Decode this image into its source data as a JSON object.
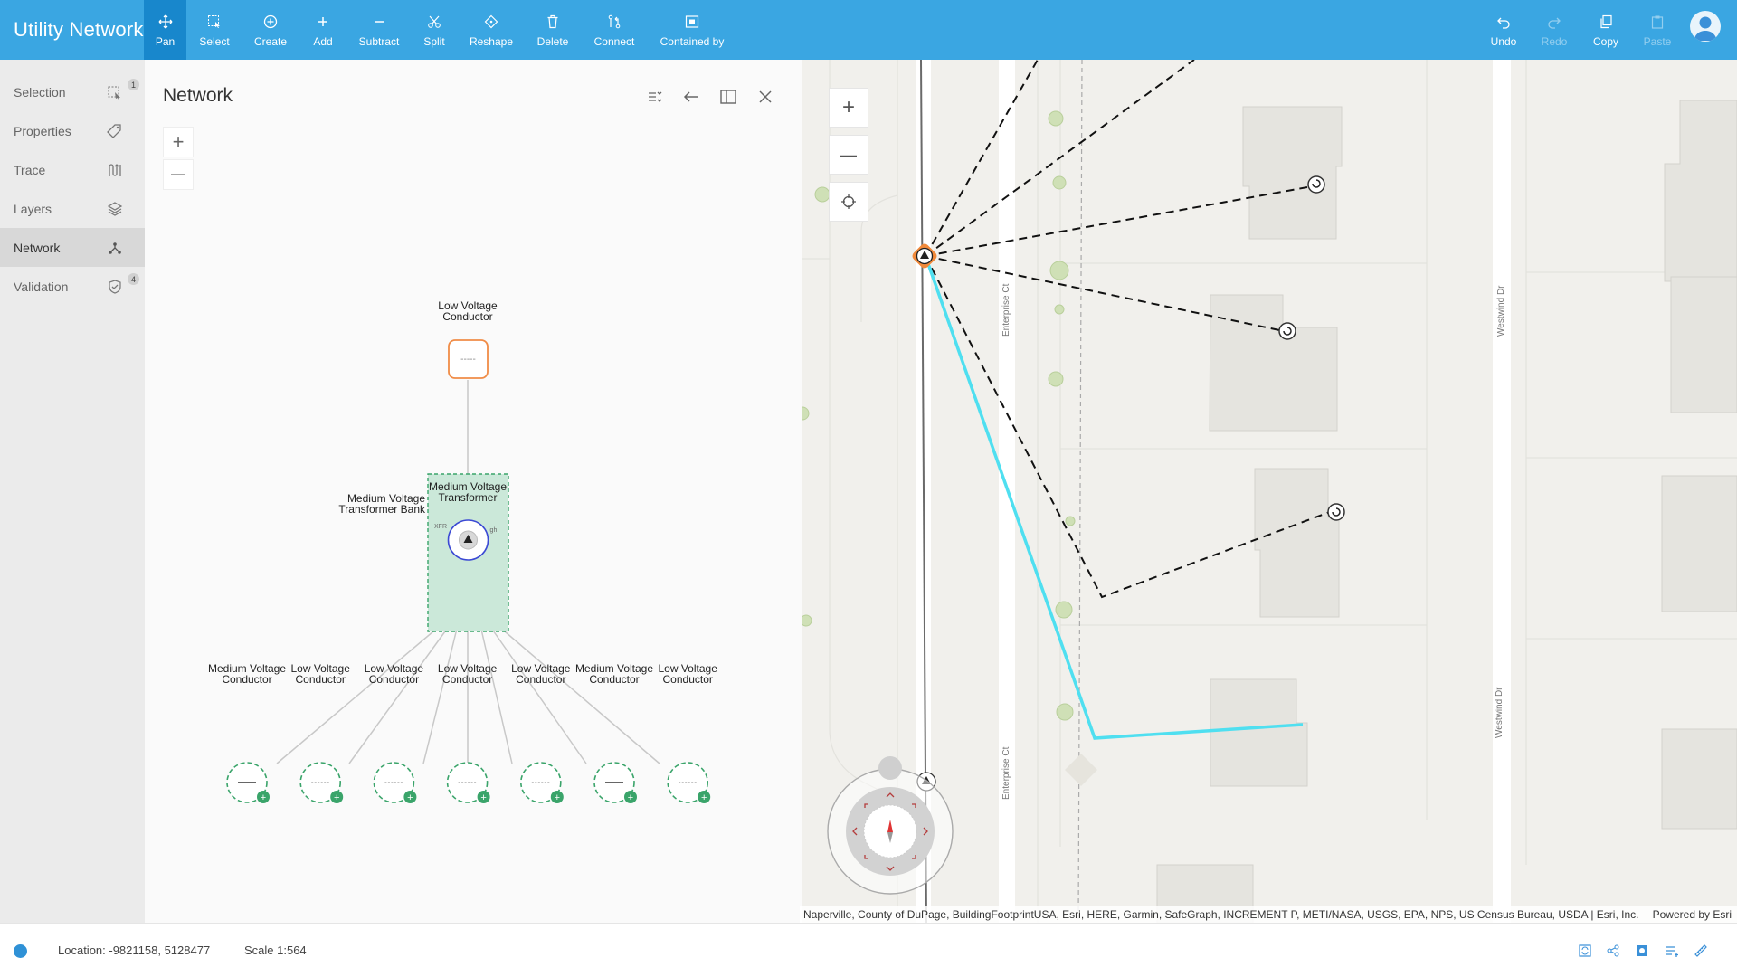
{
  "app": {
    "title": "Utility Network"
  },
  "toolbar": {
    "left_tools": [
      {
        "label": "Pan",
        "icon": "pan-icon",
        "active": true
      },
      {
        "label": "Select",
        "icon": "select-icon"
      },
      {
        "label": "Create",
        "icon": "create-icon"
      },
      {
        "label": "Add",
        "icon": "add-icon"
      },
      {
        "label": "Subtract",
        "icon": "subtract-icon"
      },
      {
        "label": "Split",
        "icon": "split-icon"
      },
      {
        "label": "Reshape",
        "icon": "reshape-icon"
      },
      {
        "label": "Delete",
        "icon": "delete-icon"
      },
      {
        "label": "Connect",
        "icon": "connect-icon"
      },
      {
        "label": "Contained by",
        "icon": "contained-by-icon"
      }
    ],
    "right_tools": [
      {
        "label": "Undo",
        "icon": "undo-icon",
        "enabled": true
      },
      {
        "label": "Redo",
        "icon": "redo-icon",
        "enabled": false
      },
      {
        "label": "Copy",
        "icon": "copy-icon",
        "enabled": true
      },
      {
        "label": "Paste",
        "icon": "paste-icon",
        "enabled": false
      }
    ]
  },
  "sidebar": {
    "items": [
      {
        "label": "Selection",
        "icon": "selection-icon",
        "badge": "1"
      },
      {
        "label": "Properties",
        "icon": "properties-icon"
      },
      {
        "label": "Trace",
        "icon": "trace-icon"
      },
      {
        "label": "Layers",
        "icon": "layers-icon"
      },
      {
        "label": "Network",
        "icon": "network-icon",
        "active": true
      },
      {
        "label": "Validation",
        "icon": "validation-icon",
        "badge": "4"
      }
    ]
  },
  "panel": {
    "title": "Network",
    "zoom_in": "+",
    "zoom_out": "—"
  },
  "diagram": {
    "top_node": {
      "label": "Low Voltage Conductor",
      "symbol": "-----"
    },
    "bank_label": "Medium Voltage Transformer Bank",
    "transformer_label": "Medium Voltage Transformer",
    "transformer_small_left": "XFR",
    "transformer_small_right": "igh",
    "children": [
      {
        "label": "Medium Voltage Conductor",
        "type": "medium"
      },
      {
        "label": "Low Voltage Conductor",
        "type": "low"
      },
      {
        "label": "Low Voltage Conductor",
        "type": "low"
      },
      {
        "label": "Low Voltage Conductor",
        "type": "low"
      },
      {
        "label": "Low Voltage Conductor",
        "type": "low"
      },
      {
        "label": "Medium Voltage Conductor",
        "type": "medium"
      },
      {
        "label": "Low Voltage Conductor",
        "type": "low"
      }
    ],
    "expand_symbol": "+"
  },
  "map": {
    "zoom_in": "+",
    "zoom_out": "—",
    "streets": [
      "Enterprise Ct",
      "Enterprise Ct",
      "Westwind Dr",
      "Westwind Dr"
    ],
    "attribution": "Naperville, County of DuPage, BuildingFootprintUSA, Esri, HERE, Garmin, SafeGraph, INCREMENT P, METI/NASA, USGS, EPA, NPS, US Census Bureau, USDA | Esri, Inc.",
    "powered_by": "Powered by Esri",
    "colors": {
      "trace": "#4fdff0",
      "transformer": "#f18a3b"
    }
  },
  "status": {
    "location": "Location: -9821158, 5128477",
    "scale": "Scale 1:564"
  }
}
